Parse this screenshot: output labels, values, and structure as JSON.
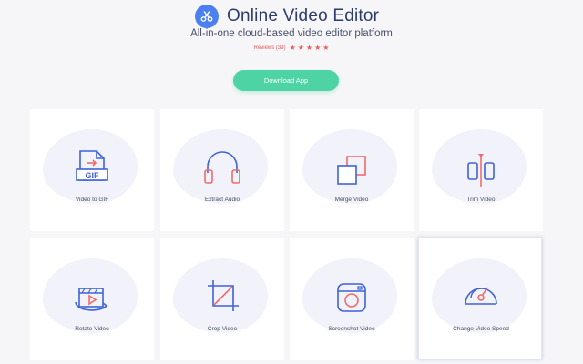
{
  "header": {
    "title": "Online Video Editor",
    "subtitle": "All-in-one cloud-based video editor platform",
    "reviews_text": "Reviews (39)",
    "rating_stars": 5,
    "download_label": "Download App"
  },
  "colors": {
    "accent_green": "#4ed4a4",
    "icon_blue": "#3f63d8",
    "icon_red": "#f06c6c",
    "brand_blue": "#4a80f0"
  },
  "tools": [
    {
      "label": "Video to GIF",
      "icon": "gif-file-icon"
    },
    {
      "label": "Extract Audio",
      "icon": "headphones-icon"
    },
    {
      "label": "Merge Video",
      "icon": "merge-squares-icon"
    },
    {
      "label": "Trim Video",
      "icon": "trim-icon"
    },
    {
      "label": "Rotate Video",
      "icon": "rotate-video-icon"
    },
    {
      "label": "Crop Video",
      "icon": "crop-icon"
    },
    {
      "label": "Screenshot Video",
      "icon": "camera-icon"
    },
    {
      "label": "Change Video Speed",
      "icon": "speedometer-icon"
    }
  ]
}
